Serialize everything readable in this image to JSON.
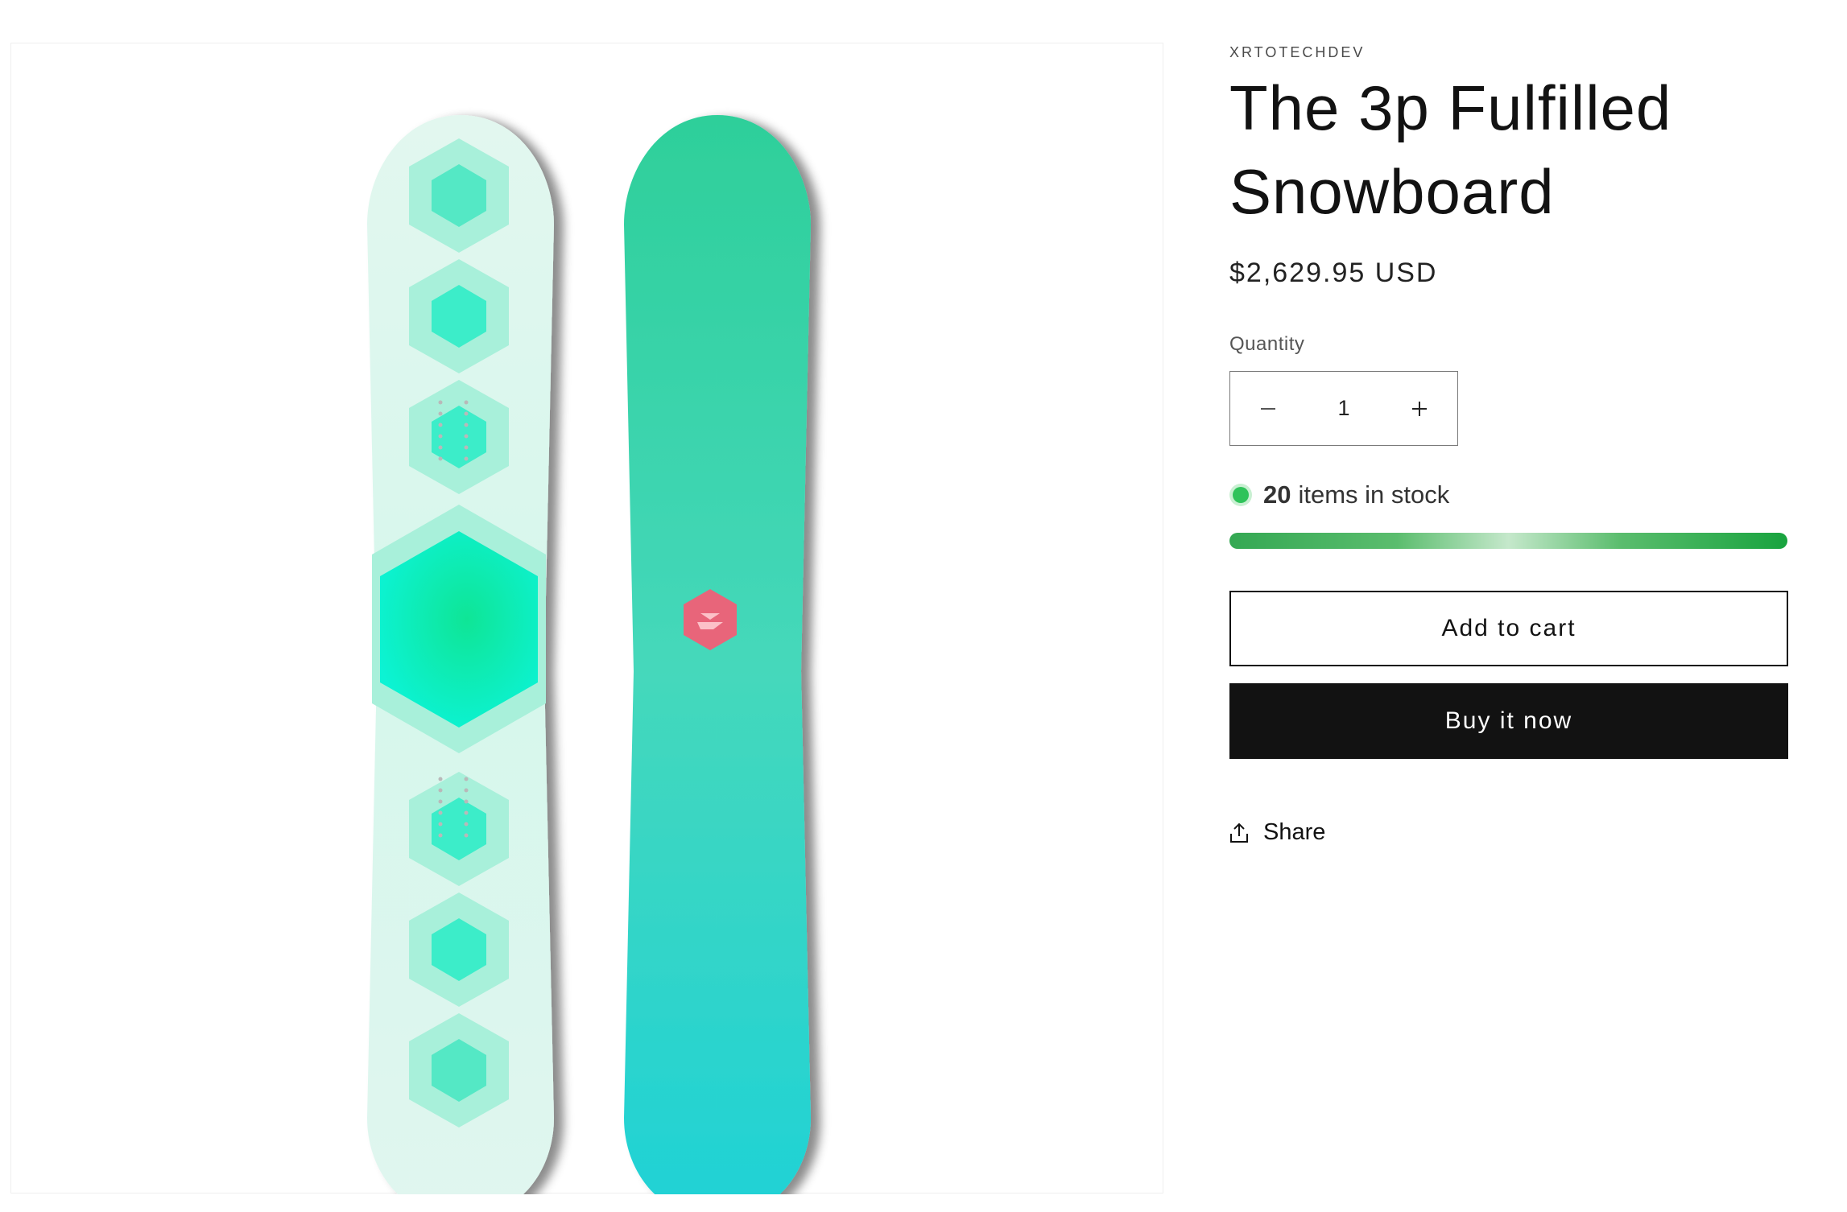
{
  "product": {
    "vendor": "XRTOTECHDEV",
    "title": "The 3p Fulfilled Snowboard",
    "price": "$2,629.95 USD"
  },
  "quantity": {
    "label": "Quantity",
    "value": "1",
    "decrease_icon": "minus-icon",
    "increase_icon": "plus-icon"
  },
  "inventory": {
    "count": "20",
    "text": "items in stock",
    "level": 1.0,
    "status_color": "#2fc35a"
  },
  "actions": {
    "add_to_cart": "Add to cart",
    "buy_now": "Buy it now",
    "share": "Share",
    "share_icon": "share-icon"
  },
  "colors": {
    "accent": "#121212",
    "board_top": "#2ecf9e",
    "board_logo": "#e8657a"
  }
}
